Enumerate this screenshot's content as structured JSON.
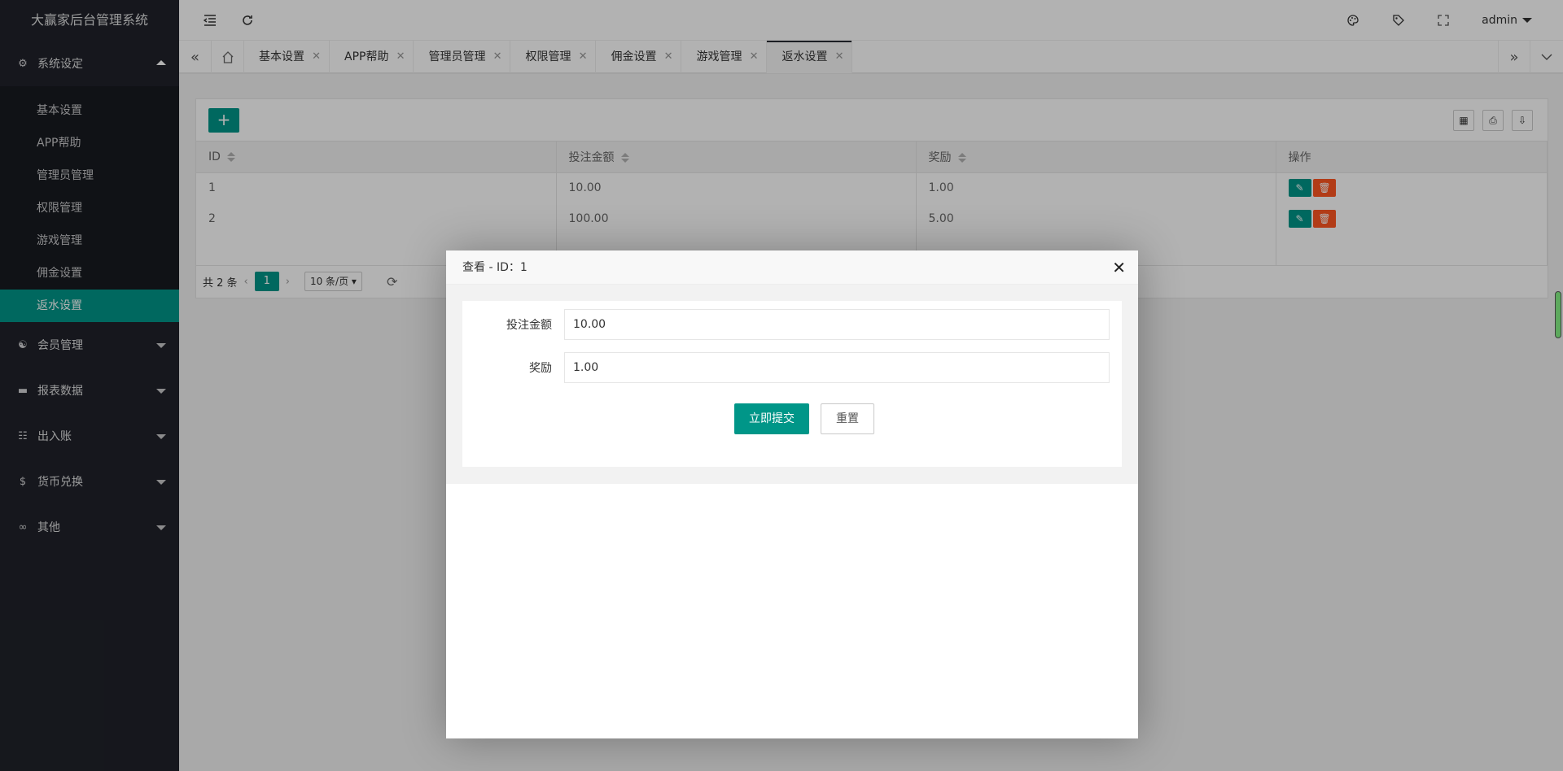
{
  "app": {
    "title": "大赢家后台管理系统"
  },
  "sidebar": {
    "groups": [
      {
        "label": "系统设定",
        "icon": "gear-icon",
        "expanded": true,
        "items": [
          {
            "label": "基本设置"
          },
          {
            "label": "APP帮助"
          },
          {
            "label": "管理员管理"
          },
          {
            "label": "权限管理"
          },
          {
            "label": "游戏管理"
          },
          {
            "label": "佣金设置"
          },
          {
            "label": "返水设置",
            "active": true
          }
        ]
      },
      {
        "label": "会员管理",
        "icon": "user-icon"
      },
      {
        "label": "报表数据",
        "icon": "report-icon"
      },
      {
        "label": "出入账",
        "icon": "book-icon"
      },
      {
        "label": "货币兑换",
        "icon": "dollar-icon"
      },
      {
        "label": "其他",
        "icon": "infinity-icon"
      }
    ]
  },
  "header": {
    "user": "admin"
  },
  "tabs": [
    {
      "label": "基本设置"
    },
    {
      "label": "APP帮助"
    },
    {
      "label": "管理员管理"
    },
    {
      "label": "权限管理"
    },
    {
      "label": "佣金设置"
    },
    {
      "label": "游戏管理"
    },
    {
      "label": "返水设置",
      "active": true
    }
  ],
  "table": {
    "columns": [
      "ID",
      "投注金额",
      "奖励",
      "操作"
    ],
    "rows": [
      {
        "id": "1",
        "amount": "10.00",
        "reward": "1.00"
      },
      {
        "id": "2",
        "amount": "100.00",
        "reward": "5.00"
      }
    ]
  },
  "pager": {
    "total": "共 2 条",
    "current": "1",
    "page_size": "10 条/页"
  },
  "modal": {
    "title": "查看 - ID：1",
    "fields": [
      {
        "label": "投注金额",
        "value": "10.00"
      },
      {
        "label": "奖励",
        "value": "1.00"
      }
    ],
    "submit": "立即提交",
    "reset": "重置"
  },
  "colors": {
    "primary": "#009688",
    "danger": "#FF5722",
    "sidebar": "#20222a"
  }
}
